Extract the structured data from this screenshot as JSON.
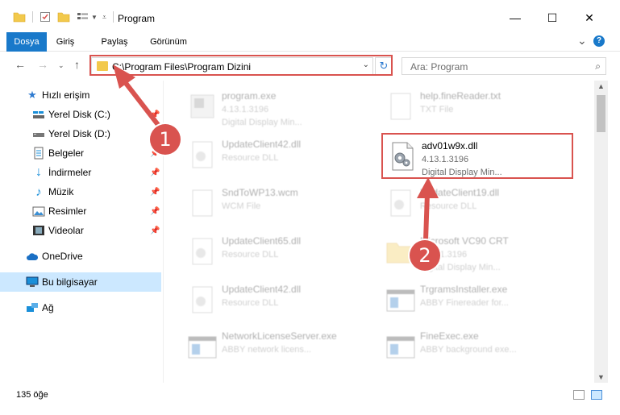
{
  "window": {
    "title": "Program",
    "minimize": "—",
    "maximize": "☐",
    "close": "✕"
  },
  "ribbon": {
    "tabs": [
      {
        "label": "Dosya",
        "active": true
      },
      {
        "label": "Giriş",
        "active": false
      },
      {
        "label": "Paylaş",
        "active": false
      },
      {
        "label": "Görünüm",
        "active": false
      }
    ],
    "expand": "⌄",
    "help": "?"
  },
  "address_bar": {
    "path": "C:\\Program Files\\Program Dizini",
    "search_placeholder": "Ara: Program"
  },
  "sidebar": {
    "items": [
      {
        "label": "Hızlı erişim",
        "icon": "star-icon",
        "pinned": false
      },
      {
        "label": "Yerel Disk (C:)",
        "icon": "drive-icon",
        "pinned": true
      },
      {
        "label": "Yerel Disk (D:)",
        "icon": "drive-icon",
        "pinned": true
      },
      {
        "label": "Belgeler",
        "icon": "documents-icon",
        "pinned": true
      },
      {
        "label": "İndirmeler",
        "icon": "download-icon",
        "pinned": true
      },
      {
        "label": "Müzik",
        "icon": "music-icon",
        "pinned": true
      },
      {
        "label": "Resimler",
        "icon": "pictures-icon",
        "pinned": true
      },
      {
        "label": "Videolar",
        "icon": "videos-icon",
        "pinned": true
      },
      {
        "label": "OneDrive",
        "icon": "cloud-icon",
        "pinned": false
      },
      {
        "label": "Bu bilgisayar",
        "icon": "computer-icon",
        "pinned": false
      },
      {
        "label": "Ağ",
        "icon": "network-icon",
        "pinned": false
      }
    ]
  },
  "files": [
    {
      "name": "program.exe",
      "line2": "4.13.1.3196",
      "line3": "Digital Display Min...",
      "icon": "exe-icon",
      "faded": true
    },
    {
      "name": "help.fineReader.txt",
      "line2": "TXT File",
      "line3": "",
      "icon": "text-file-icon",
      "faded": true
    },
    {
      "name": "UpdateClient42.dll",
      "line2": "Resource DLL",
      "line3": "",
      "icon": "dll-icon",
      "faded": true
    },
    {
      "name": "adv01w9x.dll",
      "line2": "4.13.1.3196",
      "line3": "Digital Display Min...",
      "icon": "dll-gear-icon",
      "faded": false
    },
    {
      "name": "SndToWP13.wcm",
      "line2": "WCM File",
      "line3": "",
      "icon": "file-icon",
      "faded": true
    },
    {
      "name": "UpdateClient19.dll",
      "line2": "Resource DLL",
      "line3": "",
      "icon": "dll-icon",
      "faded": true
    },
    {
      "name": "UpdateClient65.dll",
      "line2": "Resource DLL",
      "line3": "",
      "icon": "dll-icon",
      "faded": true
    },
    {
      "name": "Microsoft VC90 CRT",
      "line2": "4.13.1.3196",
      "line3": "Digital Display Min...",
      "icon": "folder-icon",
      "faded": true
    },
    {
      "name": "UpdateClient42.dll",
      "line2": "Resource DLL",
      "line3": "",
      "icon": "dll-icon",
      "faded": true
    },
    {
      "name": "TrgramsInstaller.exe",
      "line2": "ABBY Finereader for...",
      "line3": "",
      "icon": "app-window-icon",
      "faded": true
    },
    {
      "name": "NetworkLicenseServer.exe",
      "line2": "ABBY network licens...",
      "line3": "",
      "icon": "app-window-icon",
      "faded": true
    },
    {
      "name": "FineExec.exe",
      "line2": "ABBY background exe...",
      "line3": "",
      "icon": "app-window-icon",
      "faded": true
    }
  ],
  "status": {
    "count": "135 öğe"
  },
  "callouts": {
    "one": "1",
    "two": "2"
  },
  "colors": {
    "accent": "#1979ca",
    "highlight": "#d9534f",
    "selected": "#cce8ff"
  }
}
